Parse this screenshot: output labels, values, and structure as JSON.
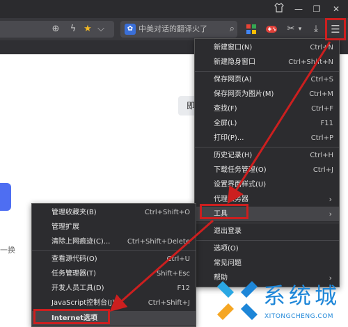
{
  "window": {
    "shirt_icon": "shirt-icon",
    "minimize": "—",
    "restore": "❐",
    "close": "✕"
  },
  "toolbar": {
    "zoom": "⊕",
    "bolt": "ϟ",
    "star": "★",
    "chevron": "⌵",
    "search_text": "中美对话的翻译火了",
    "search_btn": "⌕",
    "scissors": "✂",
    "download": "⤓",
    "menu": "☰"
  },
  "page": {
    "grey_button": "即",
    "switch_text": "一换"
  },
  "main_menu": {
    "items": [
      {
        "label": "新建窗口(N)",
        "shortcut": "Ctrl+N"
      },
      {
        "label": "新建隐身窗口",
        "shortcut": "Ctrl+Shift+N"
      },
      {
        "label": "保存网页(A)",
        "shortcut": "Ctrl+S"
      },
      {
        "label": "保存网页为图片(M)",
        "shortcut": "Ctrl+M"
      },
      {
        "label": "查找(F)",
        "shortcut": "Ctrl+F"
      },
      {
        "label": "全屏(L)",
        "shortcut": "F11"
      },
      {
        "label": "打印(P)...",
        "shortcut": "Ctrl+P"
      },
      {
        "label": "历史记录(H)",
        "shortcut": "Ctrl+H"
      },
      {
        "label": "下载任务管理(O)",
        "shortcut": "Ctrl+J"
      },
      {
        "label": "设置界面样式(U)",
        "shortcut": ""
      },
      {
        "label": "代理服务器",
        "shortcut": ""
      },
      {
        "label": "工具",
        "shortcut": ""
      },
      {
        "label": "退出登录",
        "shortcut": ""
      },
      {
        "label": "选项(O)",
        "shortcut": ""
      },
      {
        "label": "常见问题",
        "shortcut": ""
      },
      {
        "label": "帮助",
        "shortcut": ""
      }
    ]
  },
  "sub_menu": {
    "items": [
      {
        "label": "管理收藏夹(B)",
        "shortcut": "Ctrl+Shift+O"
      },
      {
        "label": "管理扩展",
        "shortcut": ""
      },
      {
        "label": "清除上网痕迹(C)...",
        "shortcut": "Ctrl+Shift+Delete"
      },
      {
        "label": "查看源代码(O)",
        "shortcut": "Ctrl+U"
      },
      {
        "label": "任务管理器(T)",
        "shortcut": "Shift+Esc"
      },
      {
        "label": "开发人员工具(D)",
        "shortcut": "F12"
      },
      {
        "label": "JavaScript控制台(J)",
        "shortcut": "Ctrl+Shift+J"
      },
      {
        "label": "Internet选项",
        "shortcut": ""
      }
    ]
  },
  "watermark": {
    "text": "系统城",
    "url": "XITONGCHENG.COM"
  },
  "colors": {
    "annotation_red": "#cc1f1f",
    "watermark_blue": "#1d86d8"
  }
}
